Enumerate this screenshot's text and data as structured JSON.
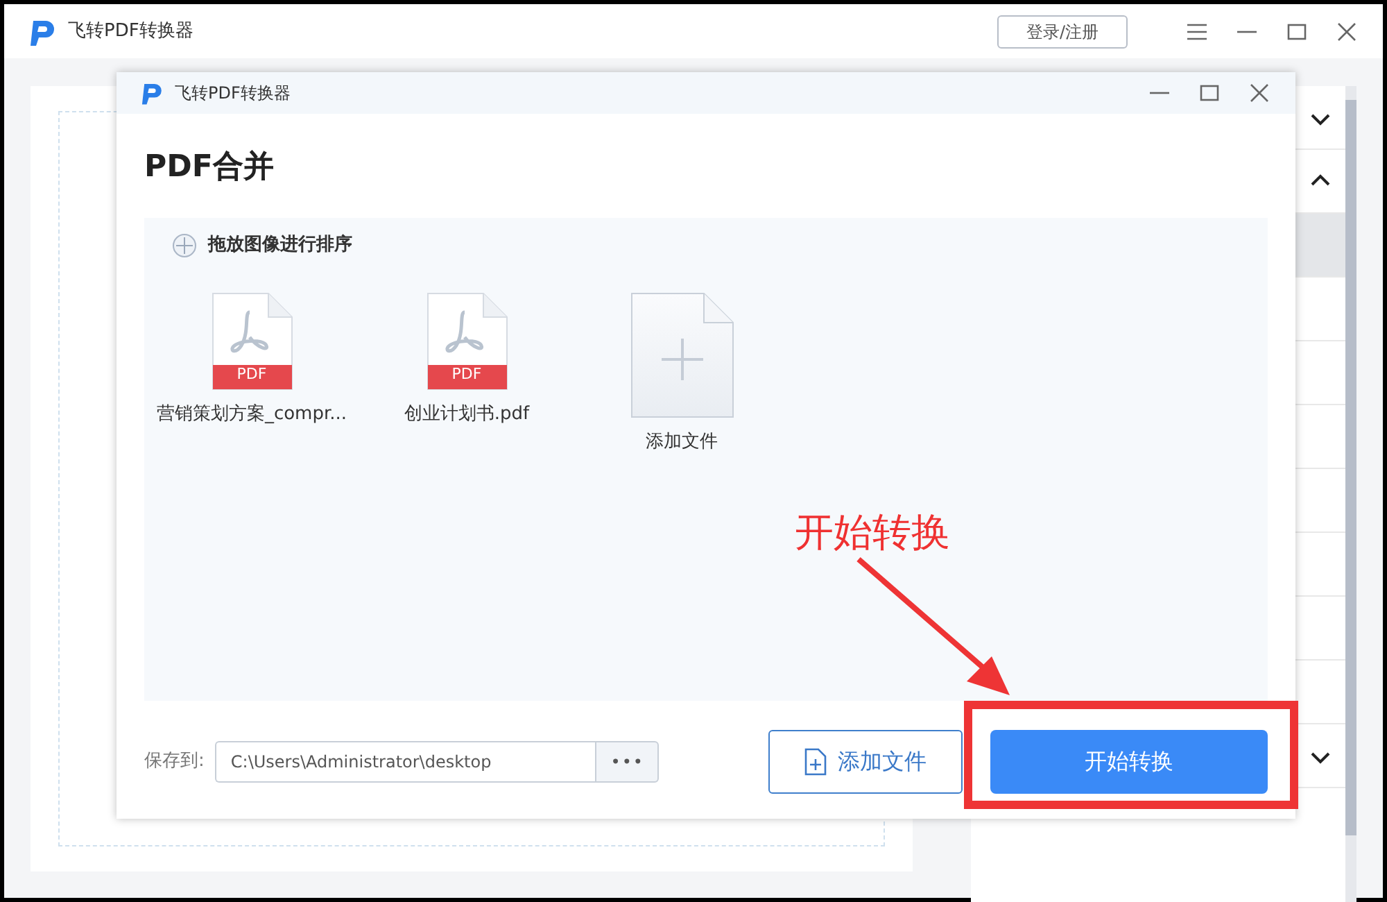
{
  "app": {
    "title": "飞转PDF转换器",
    "login_button": "登录/注册"
  },
  "sidebar": {
    "groups": [
      {
        "expanded": false
      },
      {
        "expanded": true,
        "rows": [
          {
            "selected": true
          },
          {
            "selected": false
          },
          {
            "selected": false
          },
          {
            "selected": false
          },
          {
            "selected": false
          },
          {
            "selected": false
          },
          {
            "selected": false
          },
          {
            "selected": false
          }
        ]
      },
      {
        "expanded": false
      }
    ]
  },
  "dialog": {
    "title": "飞转PDF转换器",
    "heading": "PDF合并",
    "hint": "拖放图像进行排序",
    "files": [
      {
        "kind": "pdf",
        "name": "营销策划方案_compr...",
        "badge": "PDF"
      },
      {
        "kind": "pdf",
        "name": "创业计划书.pdf",
        "badge": "PDF"
      },
      {
        "kind": "add",
        "name": "添加文件"
      }
    ],
    "save_label": "保存到:",
    "save_path": "C:\\Users\\Administrator\\desktop",
    "browse_button": "•••",
    "add_button": "添加文件",
    "start_button": "开始转换"
  },
  "annotation": {
    "text": "开始转换"
  }
}
